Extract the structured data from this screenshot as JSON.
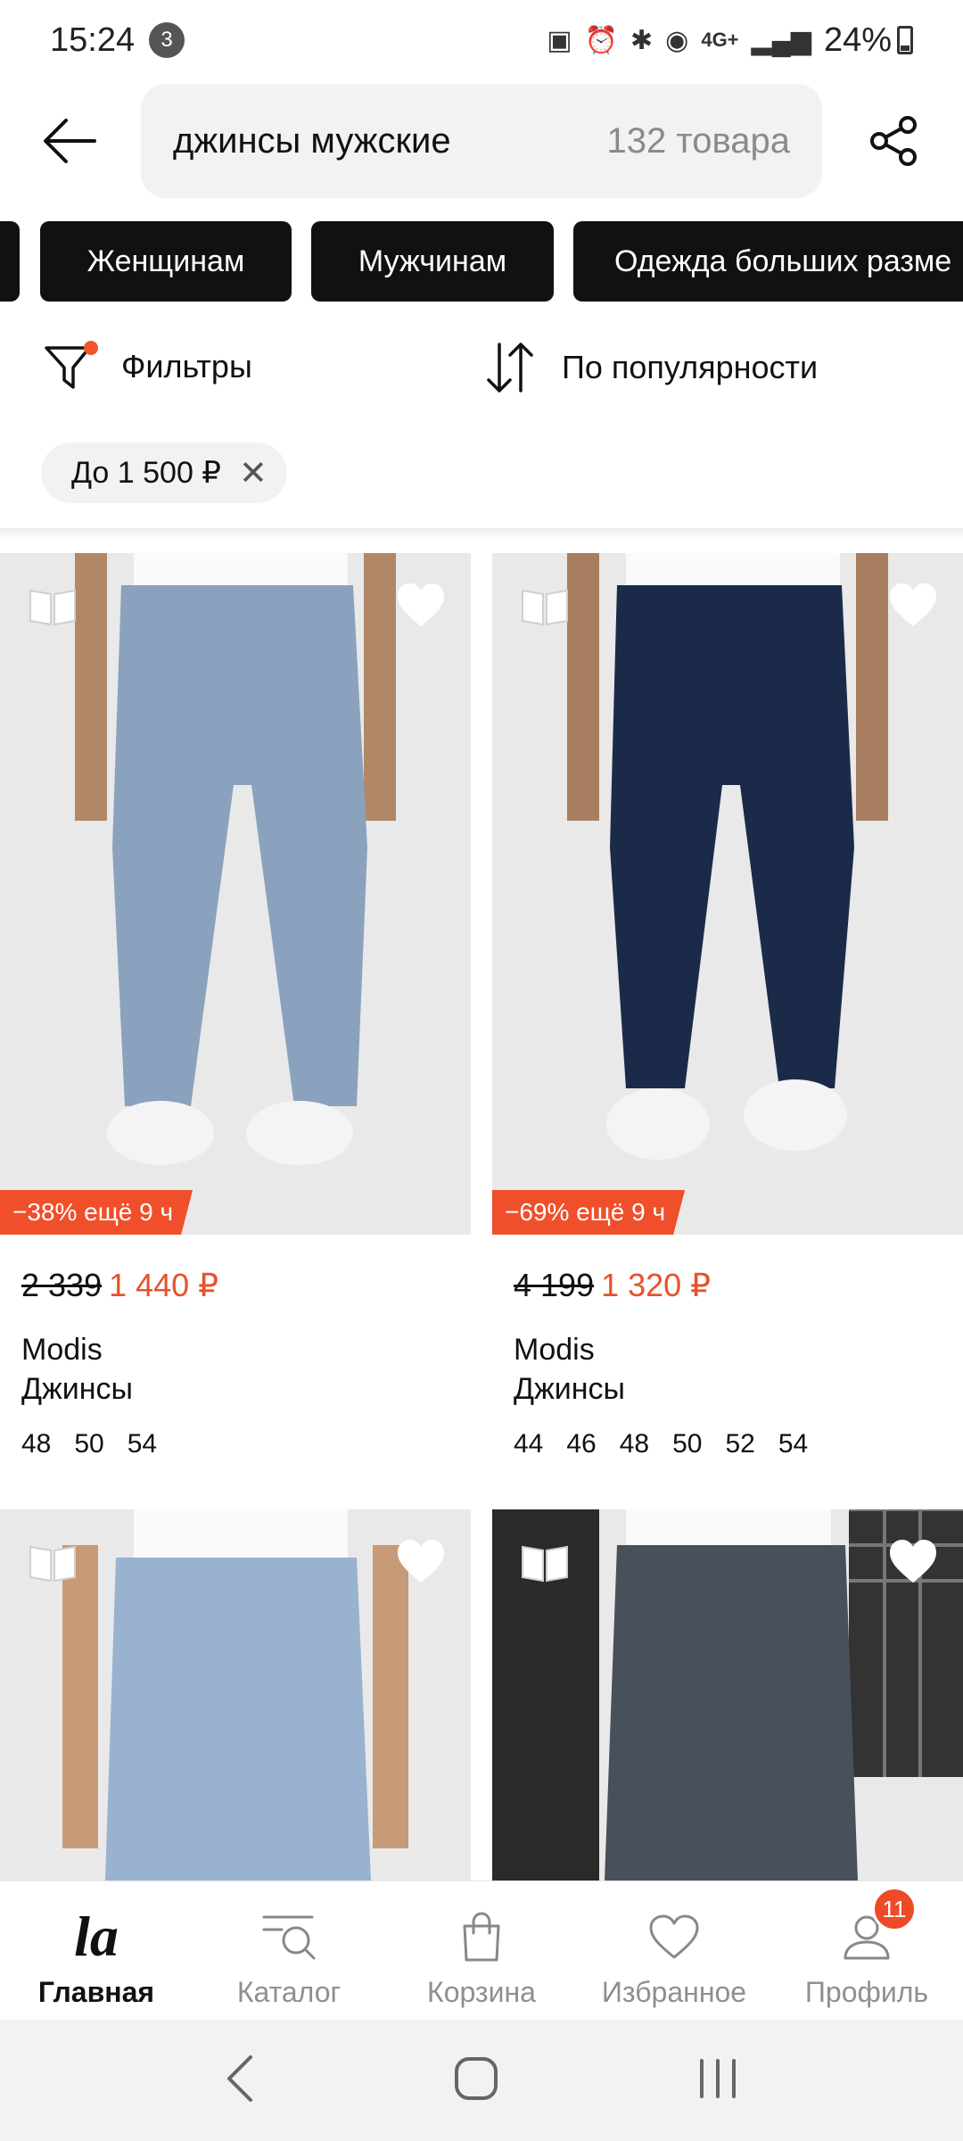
{
  "status_bar": {
    "time": "15:24",
    "notification_count": "3",
    "network": "4G+",
    "battery": "24%"
  },
  "search": {
    "query": "джинсы мужские",
    "result_count": "132 товара"
  },
  "categories": [
    "Женщинам",
    "Мужчинам",
    "Одежда больших разме"
  ],
  "filters": {
    "filters_label": "Фильтры",
    "sort_label": "По популярности",
    "active_price_chip": "До 1 500 ₽"
  },
  "products": [
    {
      "promo": "−38% ещё 9 ч",
      "old_price": "2 339",
      "new_price": "1 440 ₽",
      "brand": "Modis",
      "type": "Джинсы",
      "sizes": [
        "48",
        "50",
        "54"
      ],
      "jeans_color": "#8aa2bd"
    },
    {
      "promo": "−69% ещё 9 ч",
      "old_price": "4 199",
      "new_price": "1 320 ₽",
      "brand": "Modis",
      "type": "Джинсы",
      "sizes": [
        "44",
        "46",
        "48",
        "50",
        "52",
        "54"
      ],
      "jeans_color": "#1c2a4a"
    },
    {
      "jeans_color": "#98b2cf"
    },
    {
      "jeans_color": "#48505c"
    }
  ],
  "tabbar": {
    "home": "Главная",
    "home_logo": "la",
    "catalog": "Каталог",
    "cart": "Корзина",
    "favorites": "Избранное",
    "profile": "Профиль",
    "profile_badge": "11"
  },
  "colors": {
    "accent": "#ef4f2a",
    "chip_bg": "#111111"
  }
}
